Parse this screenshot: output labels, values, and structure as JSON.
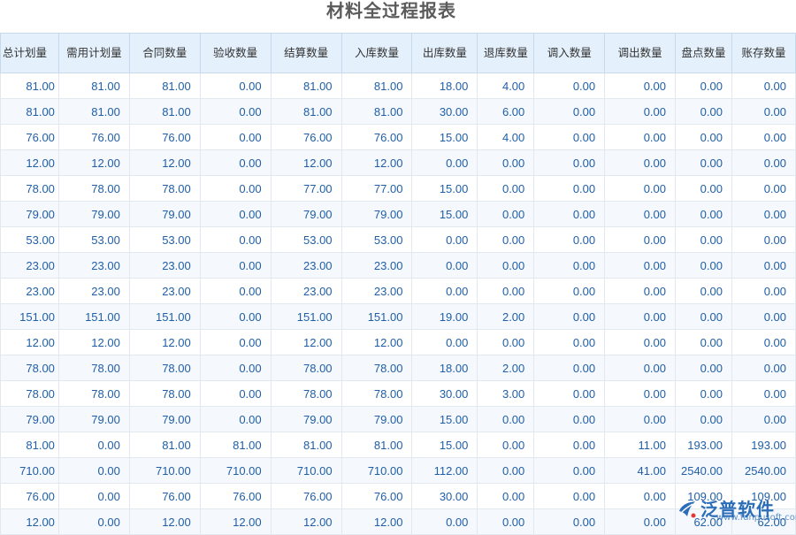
{
  "report": {
    "title": "材料全过程报表",
    "columns": [
      "总计划量",
      "需用计划量",
      "合同数量",
      "验收数量",
      "结算数量",
      "入库数量",
      "出库数量",
      "退库数量",
      "调入数量",
      "调出数量",
      "盘点数量",
      "账存数量"
    ],
    "rows": [
      [
        "81.00",
        "81.00",
        "81.00",
        "0.00",
        "81.00",
        "81.00",
        "18.00",
        "4.00",
        "0.00",
        "0.00",
        "0.00",
        "0.00"
      ],
      [
        "81.00",
        "81.00",
        "81.00",
        "0.00",
        "81.00",
        "81.00",
        "30.00",
        "6.00",
        "0.00",
        "0.00",
        "0.00",
        "0.00"
      ],
      [
        "76.00",
        "76.00",
        "76.00",
        "0.00",
        "76.00",
        "76.00",
        "15.00",
        "4.00",
        "0.00",
        "0.00",
        "0.00",
        "0.00"
      ],
      [
        "12.00",
        "12.00",
        "12.00",
        "0.00",
        "12.00",
        "12.00",
        "0.00",
        "0.00",
        "0.00",
        "0.00",
        "0.00",
        "0.00"
      ],
      [
        "78.00",
        "78.00",
        "78.00",
        "0.00",
        "77.00",
        "77.00",
        "15.00",
        "0.00",
        "0.00",
        "0.00",
        "0.00",
        "0.00"
      ],
      [
        "79.00",
        "79.00",
        "79.00",
        "0.00",
        "79.00",
        "79.00",
        "15.00",
        "0.00",
        "0.00",
        "0.00",
        "0.00",
        "0.00"
      ],
      [
        "53.00",
        "53.00",
        "53.00",
        "0.00",
        "53.00",
        "53.00",
        "0.00",
        "0.00",
        "0.00",
        "0.00",
        "0.00",
        "0.00"
      ],
      [
        "23.00",
        "23.00",
        "23.00",
        "0.00",
        "23.00",
        "23.00",
        "0.00",
        "0.00",
        "0.00",
        "0.00",
        "0.00",
        "0.00"
      ],
      [
        "23.00",
        "23.00",
        "23.00",
        "0.00",
        "23.00",
        "23.00",
        "0.00",
        "0.00",
        "0.00",
        "0.00",
        "0.00",
        "0.00"
      ],
      [
        "151.00",
        "151.00",
        "151.00",
        "0.00",
        "151.00",
        "151.00",
        "19.00",
        "2.00",
        "0.00",
        "0.00",
        "0.00",
        "0.00"
      ],
      [
        "12.00",
        "12.00",
        "12.00",
        "0.00",
        "12.00",
        "12.00",
        "0.00",
        "0.00",
        "0.00",
        "0.00",
        "0.00",
        "0.00"
      ],
      [
        "78.00",
        "78.00",
        "78.00",
        "0.00",
        "78.00",
        "78.00",
        "18.00",
        "2.00",
        "0.00",
        "0.00",
        "0.00",
        "0.00"
      ],
      [
        "78.00",
        "78.00",
        "78.00",
        "0.00",
        "78.00",
        "78.00",
        "30.00",
        "3.00",
        "0.00",
        "0.00",
        "0.00",
        "0.00"
      ],
      [
        "79.00",
        "79.00",
        "79.00",
        "0.00",
        "79.00",
        "79.00",
        "15.00",
        "0.00",
        "0.00",
        "0.00",
        "0.00",
        "0.00"
      ],
      [
        "81.00",
        "0.00",
        "81.00",
        "81.00",
        "81.00",
        "81.00",
        "15.00",
        "0.00",
        "0.00",
        "11.00",
        "193.00",
        "193.00"
      ],
      [
        "710.00",
        "0.00",
        "710.00",
        "710.00",
        "710.00",
        "710.00",
        "112.00",
        "0.00",
        "0.00",
        "41.00",
        "2540.00",
        "2540.00"
      ],
      [
        "76.00",
        "0.00",
        "76.00",
        "76.00",
        "76.00",
        "76.00",
        "30.00",
        "0.00",
        "0.00",
        "0.00",
        "109.00",
        "109.00"
      ],
      [
        "12.00",
        "0.00",
        "12.00",
        "12.00",
        "12.00",
        "12.00",
        "0.00",
        "0.00",
        "0.00",
        "0.00",
        "62.00",
        "62.00"
      ]
    ]
  },
  "watermark": {
    "brand": "泛普软件",
    "url": "www.fanpusoft.com",
    "logo_icon": "fanpu-logo-icon"
  },
  "colors": {
    "header_bg": "#e4f0fb",
    "cell_text": "#1f5fa8",
    "brand_blue": "#2b6db7"
  }
}
